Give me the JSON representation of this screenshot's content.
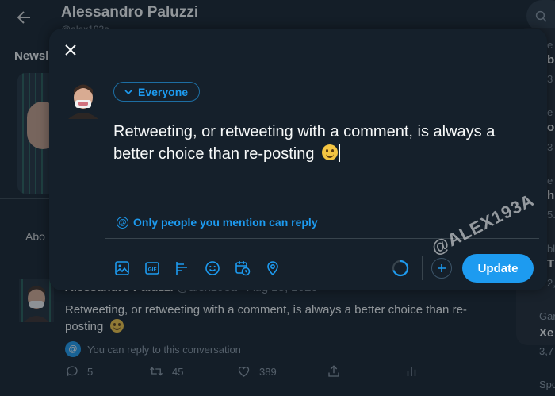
{
  "background": {
    "profile_name": "Alessandro Paluzzi",
    "profile_sub": "@alex193a",
    "left_section": "Newsl",
    "left_about": "Abo",
    "right_texts": [
      "e",
      "b",
      "3",
      "e",
      "o",
      "3",
      "e",
      "h",
      "5.",
      "bl",
      "T",
      "2,1",
      "Gar",
      "Xe",
      "3,7",
      "Spo"
    ]
  },
  "modal": {
    "audience_label": "Everyone",
    "compose_text": "Retweeting, or retweeting with a comment, is always a better choice than re-posting",
    "reply_setting": "Only people you mention can reply",
    "update_label": "Update",
    "toolbar_icons": [
      "image-icon",
      "gif-icon",
      "poll-icon",
      "emoji-icon",
      "schedule-icon",
      "location-icon"
    ]
  },
  "tweet": {
    "author_name": "Alessandro Paluzzi",
    "handle": "@alex193a",
    "separator": "·",
    "date": "Aug 25, 2020",
    "more": "···",
    "text": "Retweeting, or retweeting with a comment, is always a better choice than re-posting",
    "reply_note": "You can reply to this conversation",
    "replies": "5",
    "retweets": "45",
    "likes": "389"
  },
  "watermark": "@ALEX193A",
  "colors": {
    "accent": "#1d9bf0",
    "background": "#15202b",
    "muted": "#8b98a5",
    "border": "#38444d"
  }
}
